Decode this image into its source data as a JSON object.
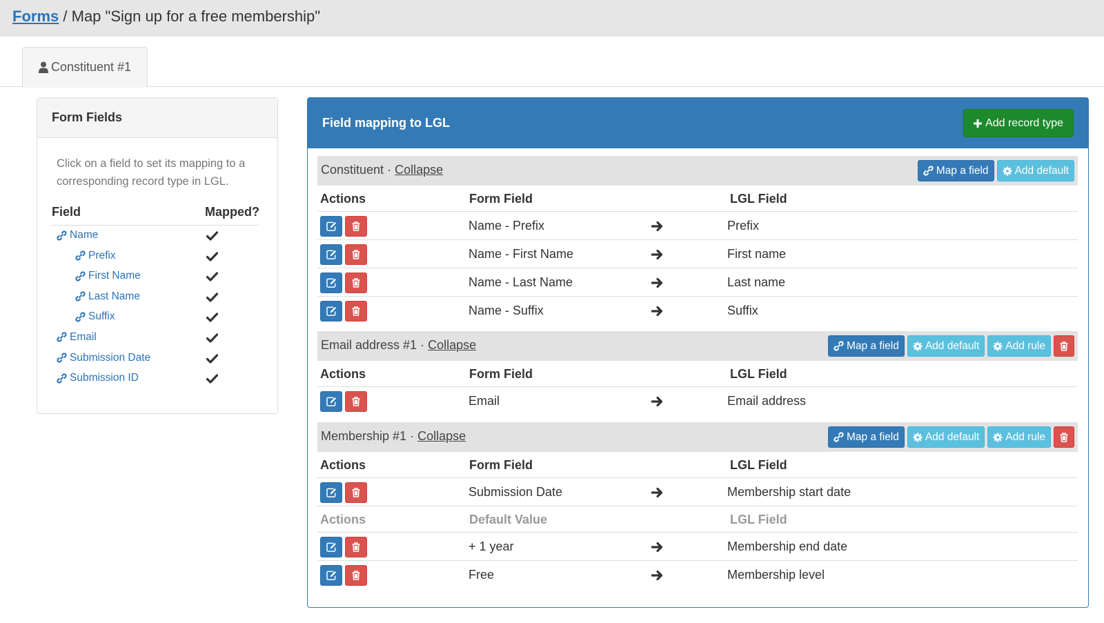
{
  "breadcrumb": {
    "link": "Forms",
    "separator": "/",
    "title": "Map \"Sign up for a free membership\""
  },
  "tab": {
    "label": "Constituent #1",
    "icon": "user-icon"
  },
  "form_fields_panel": {
    "title": "Form Fields",
    "help": "Click on a field to set its mapping to a corresponding record type in LGL.",
    "col_field": "Field",
    "col_mapped": "Mapped?",
    "fields": [
      {
        "label": "Name",
        "indent": 0,
        "mapped": true
      },
      {
        "label": "Prefix",
        "indent": 1,
        "mapped": true
      },
      {
        "label": "First Name",
        "indent": 1,
        "mapped": true
      },
      {
        "label": "Last Name",
        "indent": 1,
        "mapped": true
      },
      {
        "label": "Suffix",
        "indent": 1,
        "mapped": true
      },
      {
        "label": "Email",
        "indent": 0,
        "mapped": true
      },
      {
        "label": "Submission Date",
        "indent": 0,
        "mapped": true
      },
      {
        "label": "Submission ID",
        "indent": 0,
        "mapped": true
      }
    ]
  },
  "mapping_panel": {
    "title": "Field mapping to LGL",
    "add_record_type": "Add record type",
    "col_actions": "Actions",
    "col_form_field": "Form Field",
    "col_default_value": "Default Value",
    "col_lgl_field": "LGL Field",
    "separator": "·",
    "collapse_label": "Collapse",
    "btn_map_field": "Map a field",
    "btn_add_default": "Add default",
    "btn_add_rule": "Add rule",
    "sections": [
      {
        "name": "Constituent",
        "rows": [
          {
            "form_field": "Name - Prefix",
            "lgl_field": "Prefix"
          },
          {
            "form_field": "Name - First Name",
            "lgl_field": "First name"
          },
          {
            "form_field": "Name - Last Name",
            "lgl_field": "Last name"
          },
          {
            "form_field": "Name - Suffix",
            "lgl_field": "Suffix"
          }
        ]
      },
      {
        "name": "Email address #1",
        "rows": [
          {
            "form_field": "Email",
            "lgl_field": "Email address"
          }
        ]
      },
      {
        "name": "Membership #1",
        "rows": [
          {
            "form_field": "Submission Date",
            "lgl_field": "Membership start date"
          }
        ],
        "default_rows": [
          {
            "default_value": "+ 1 year",
            "lgl_field": "Membership end date"
          },
          {
            "default_value": "Free",
            "lgl_field": "Membership level"
          }
        ]
      }
    ]
  },
  "colors": {
    "primary": "#337ab7",
    "success": "#1c8a2c",
    "info": "#5bc0de",
    "danger": "#d9534f"
  }
}
